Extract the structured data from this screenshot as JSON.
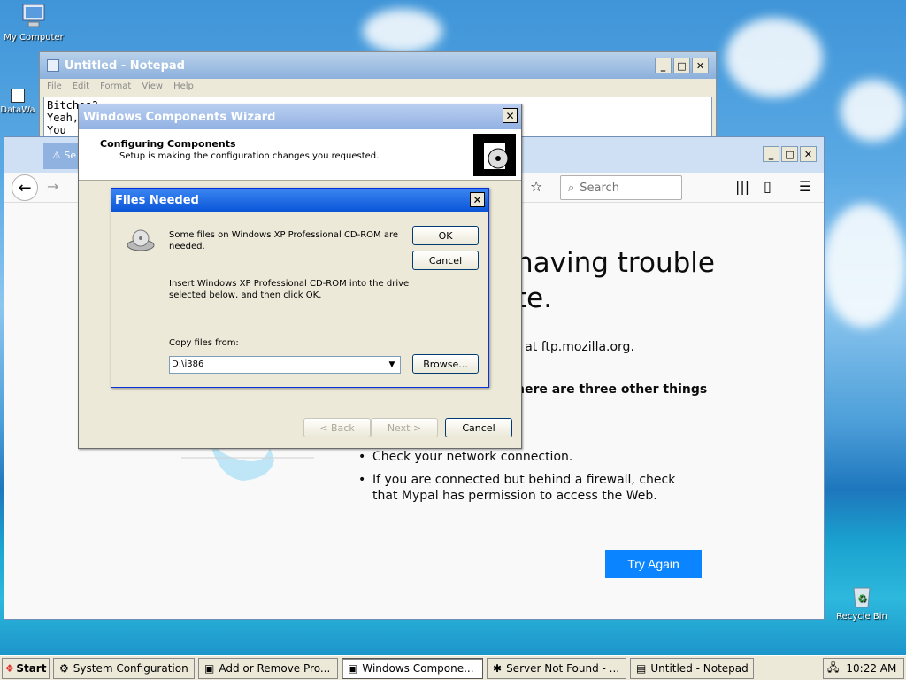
{
  "desktop": {
    "icons": [
      {
        "label": "My Computer",
        "icon": "my-computer-icon"
      },
      {
        "label": "DataWa",
        "icon": "shortcut-icon"
      },
      {
        "label": "Recycle Bin",
        "icon": "recycle-bin-icon"
      }
    ]
  },
  "notepad": {
    "title": "Untitled - Notepad",
    "menu": [
      "File",
      "Edit",
      "Format",
      "View",
      "Help"
    ],
    "text_line1": "Bitches?",
    "text_line2": "Yeah,",
    "text_line3": "You "
  },
  "browser": {
    "tab_label": "Se",
    "search_placeholder": "Search",
    "error_title_1": "naving trouble",
    "error_title_2": "te.",
    "ftp_text": "r at ftp.mozilla.org.",
    "three_text": "here are three other things",
    "list": [
      "Check your network connection.",
      "If you are connected but behind a firewall, check that Mypal has permission to access the Web."
    ],
    "try_again": "Try Again",
    "accent": "#0a84ff"
  },
  "wizard": {
    "title": "Windows Components Wizard",
    "heading": "Configuring Components",
    "subheading": "Setup is making the configuration changes you requested.",
    "back": "< Back",
    "next": "Next >",
    "cancel": "Cancel"
  },
  "files_needed": {
    "title": "Files Needed",
    "msg1a": "Some files on Windows XP Professional CD-ROM are",
    "msg1b": "needed.",
    "msg2a": "Insert Windows XP Professional CD-ROM into the drive",
    "msg2b": "selected below, and then click OK.",
    "copy_label": "Copy files from:",
    "path": "D:\\i386",
    "ok": "OK",
    "cancel": "Cancel",
    "browse": "Browse..."
  },
  "taskbar": {
    "start": "Start",
    "tasks": [
      {
        "label": "System Configuration",
        "icon": "msconfig-icon"
      },
      {
        "label": "Add or Remove Pro...",
        "icon": "add-remove-icon"
      },
      {
        "label": "Windows Compone...",
        "icon": "wizard-icon",
        "active": true
      },
      {
        "label": "Server Not Found - ...",
        "icon": "browser-icon"
      },
      {
        "label": "Untitled - Notepad",
        "icon": "notepad-icon"
      }
    ],
    "clock": "10:22 AM"
  }
}
